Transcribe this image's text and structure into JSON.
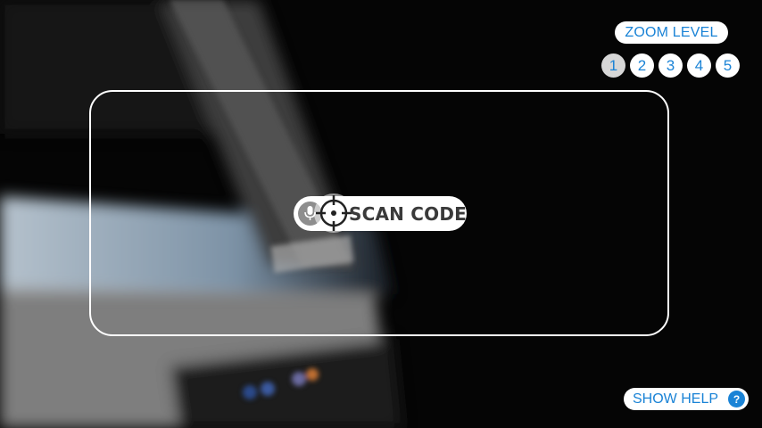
{
  "zoom": {
    "title": "ZOOM LEVEL",
    "levels": [
      "1",
      "2",
      "3",
      "4",
      "5"
    ],
    "active_level": "1"
  },
  "scan": {
    "label": "SCAN CODE"
  },
  "help": {
    "label": "SHOW HELP",
    "icon_glyph": "?"
  },
  "icons": {
    "mic": "microphone-icon",
    "crosshair": "crosshair-icon",
    "help": "question-icon"
  },
  "colors": {
    "accent": "#1a83d6",
    "frame": "#ffffff",
    "active_zoom": "#d7d7d7"
  }
}
